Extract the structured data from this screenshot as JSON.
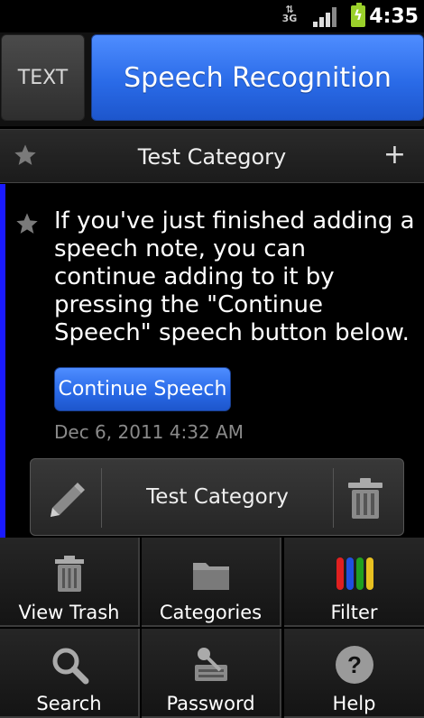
{
  "status_bar": {
    "network": "3G",
    "time": "4:35"
  },
  "top_buttons": {
    "text_mode": "TEXT",
    "speech_mode": "Speech Recognition"
  },
  "category_bar": {
    "title": "Test Category",
    "add_icon": "+"
  },
  "note": {
    "text": "If you've just finished adding a speech note, you can continue adding to it by pressing the \"Continue Speech\" speech button below.",
    "continue_button": "Continue Speech",
    "date": "Dec 6, 2011 4:32 AM",
    "accent_color": "#1a1aff"
  },
  "note_actions": {
    "category": "Test Category"
  },
  "menu": {
    "items": [
      {
        "label": "View Trash",
        "icon": "trash-icon"
      },
      {
        "label": "Categories",
        "icon": "folder-icon"
      },
      {
        "label": "Filter",
        "icon": "color-bars-icon"
      },
      {
        "label": "Search",
        "icon": "magnifier-icon"
      },
      {
        "label": "Password",
        "icon": "key-lock-icon"
      },
      {
        "label": "Help",
        "icon": "help-icon"
      }
    ]
  },
  "colors": {
    "primary_blue": "#2a6be8",
    "filter_red": "#e02020",
    "filter_blue": "#2050e0",
    "filter_green": "#20a020",
    "filter_yellow": "#e8c020"
  }
}
